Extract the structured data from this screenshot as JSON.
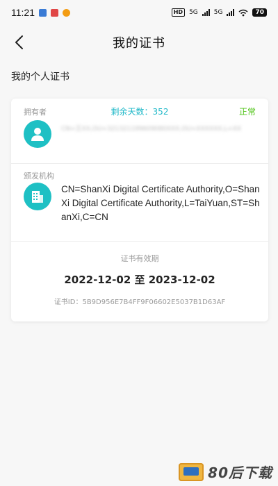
{
  "status_bar": {
    "time": "11:21",
    "hd": "HD",
    "sig1": "5G",
    "sig2": "5G",
    "battery": "70"
  },
  "header": {
    "title": "我的证书"
  },
  "section": {
    "title": "我的个人证书"
  },
  "card": {
    "owner_label": "拥有者",
    "remaining_days": "剩余天数：352",
    "status": "正常",
    "owner_value": "CN=王XX,OU=321321199609080XXX,OU=XXXXXX,L=XX",
    "issuer_label": "颁发机构",
    "issuer_value": "CN=ShanXi Digital Certificate Authority,O=ShanXi Digital Certificate Authority,L=TaiYuan,ST=ShanXi,C=CN",
    "validity_label": "证书有效期",
    "validity_range": "2022-12-02 至 2023-12-02",
    "cert_id": "证书ID：5B9D956E7B4FF9F06602E5037B1D63AF"
  },
  "watermark": {
    "text": "80后下载"
  }
}
